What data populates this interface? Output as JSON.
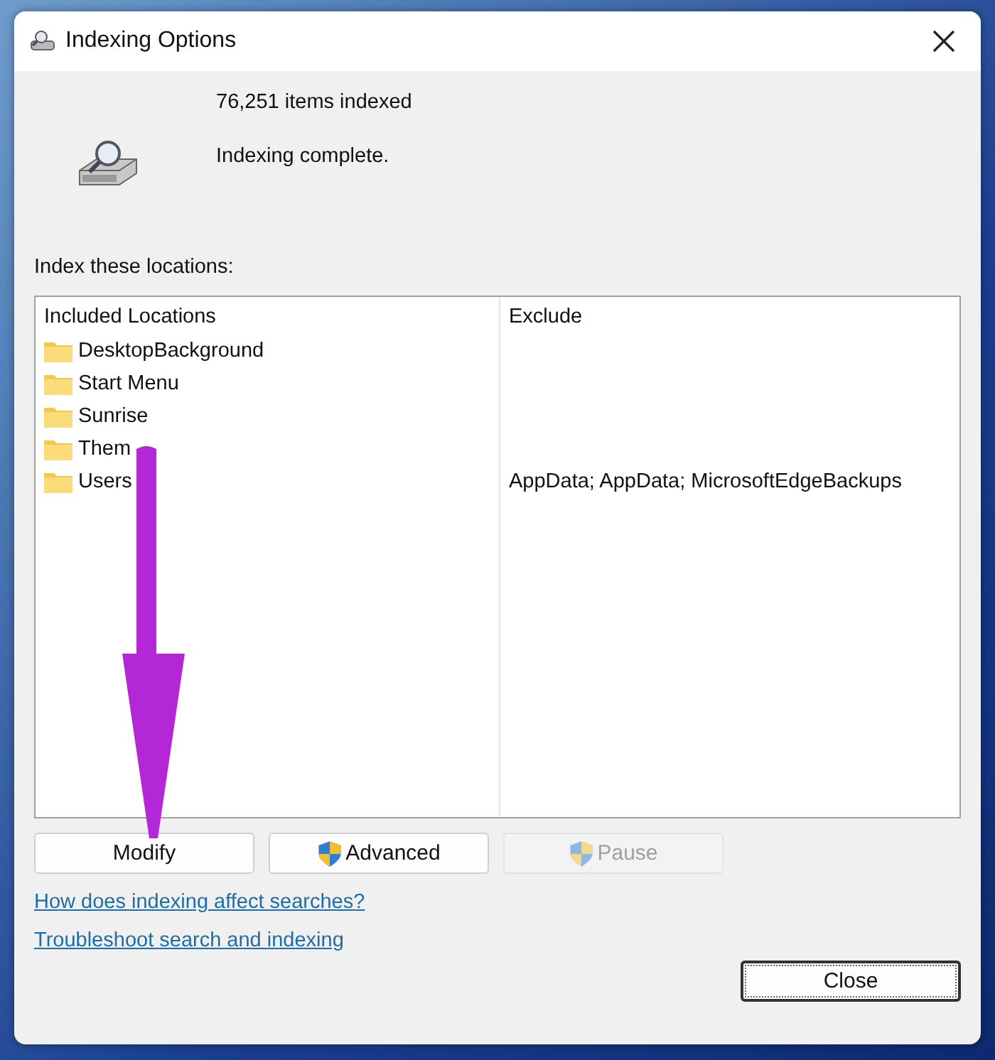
{
  "window": {
    "title": "Indexing Options"
  },
  "status": {
    "count": "76,251 items indexed",
    "message": "Indexing complete."
  },
  "locations_label": "Index these locations:",
  "table": {
    "columns": [
      "Included Locations",
      "Exclude"
    ],
    "rows": [
      {
        "location": "DesktopBackground",
        "exclude": ""
      },
      {
        "location": "Start Menu",
        "exclude": ""
      },
      {
        "location": "Sunrise",
        "exclude": ""
      },
      {
        "location": "Them",
        "exclude": ""
      },
      {
        "location": "Users",
        "exclude": "AppData; AppData; MicrosoftEdgeBackups"
      }
    ]
  },
  "buttons": [
    {
      "label": "Modify",
      "shield": false,
      "disabled": false
    },
    {
      "label": "Advanced",
      "shield": true,
      "disabled": false
    },
    {
      "label": "Pause",
      "shield": true,
      "disabled": true
    }
  ],
  "links": [
    "How does indexing affect searches?",
    "Troubleshoot search and indexing"
  ],
  "close_button": "Close"
}
